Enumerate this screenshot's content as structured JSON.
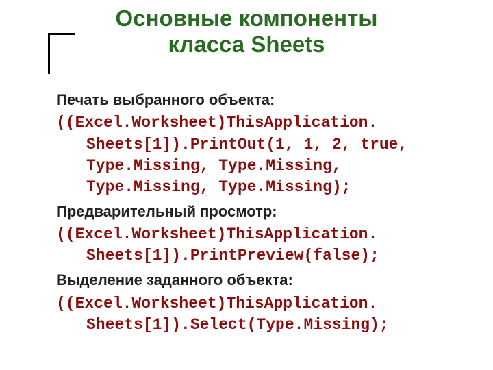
{
  "title_line1": "Основные компоненты",
  "title_line2": "класса Sheets",
  "sections": [
    {
      "label": "Печать выбранного объекта:",
      "code": "((Excel.Worksheet)ThisApplication. Sheets[1]).PrintOut(1, 1, 2, true, Type.Missing, Type.Missing, Type.Missing, Type.Missing);"
    },
    {
      "label": "Предварительный просмотр:",
      "code": "((Excel.Worksheet)ThisApplication. Sheets[1]).PrintPreview(false);"
    },
    {
      "label": "Выделение заданного объекта:",
      "code": "((Excel.Worksheet)ThisApplication. Sheets[1]).Select(Type.Missing);"
    }
  ]
}
